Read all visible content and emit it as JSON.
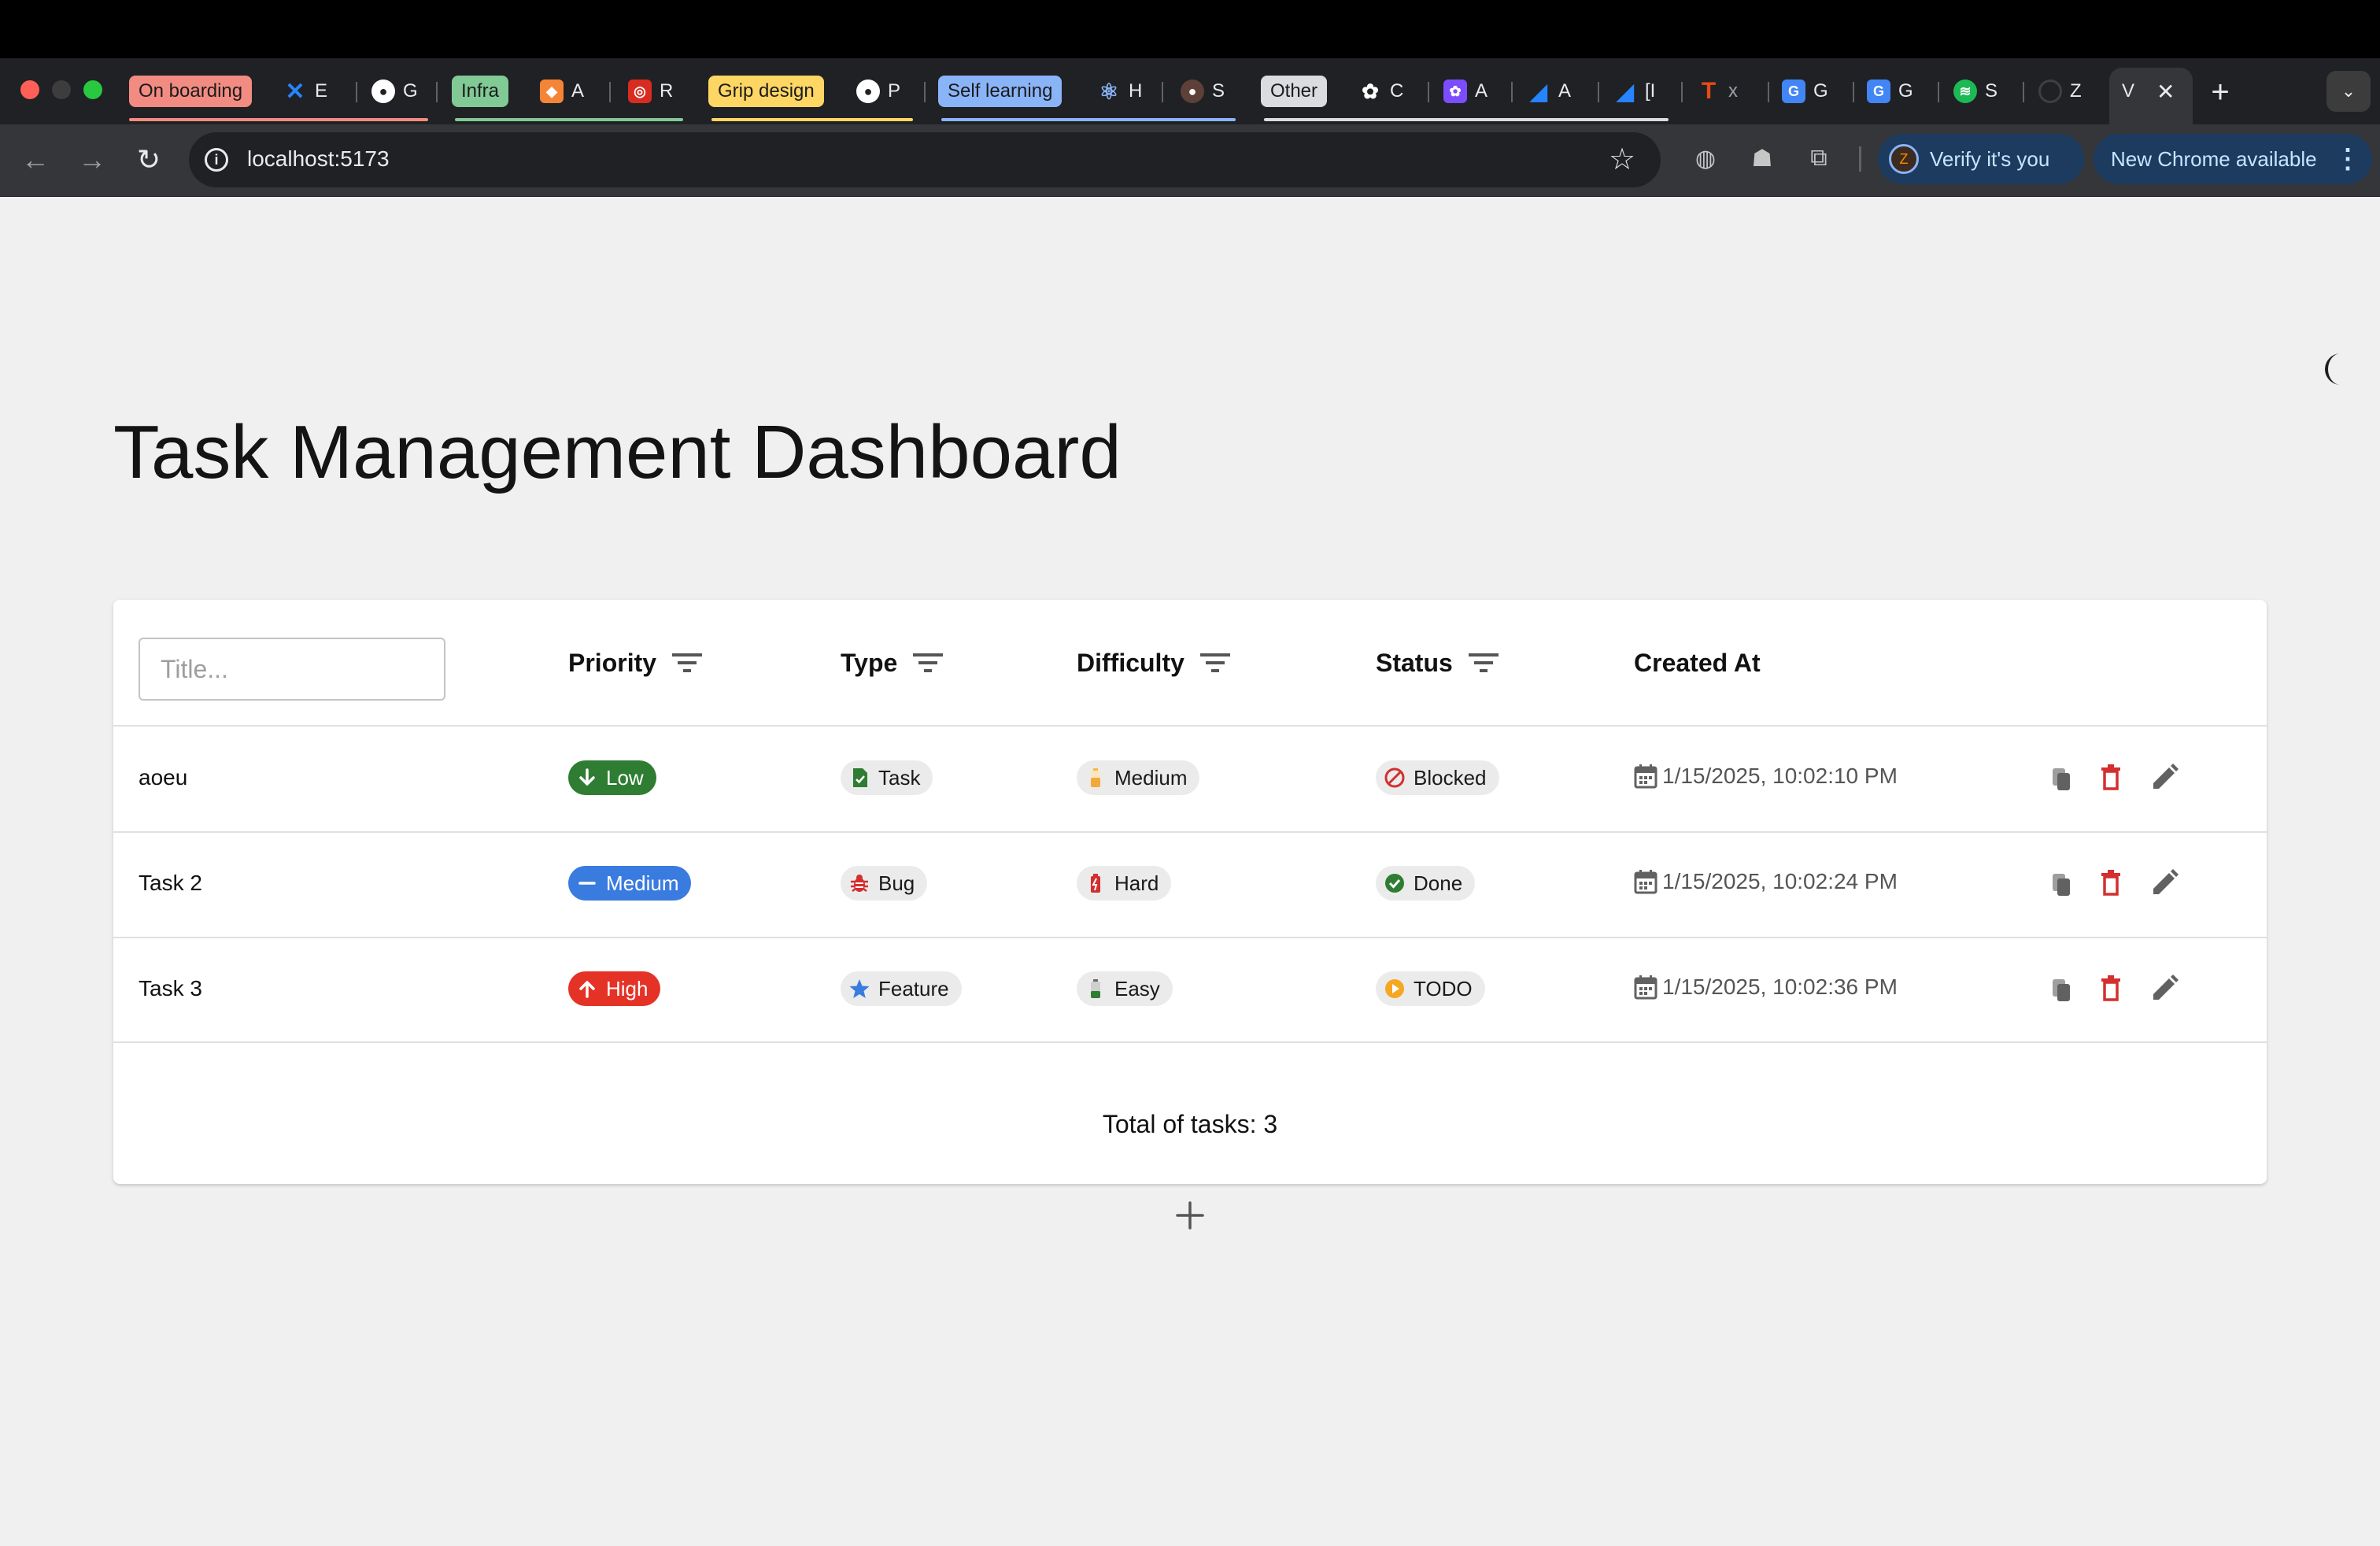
{
  "browser": {
    "tabs": [
      {
        "group": "On boarding",
        "group_color": "#f28b82"
      },
      {
        "label": "E",
        "icon": "confluence-icon"
      },
      {
        "label": "G",
        "icon": "github-icon"
      },
      {
        "group": "Infra",
        "group_color": "#81c995"
      },
      {
        "label": "A",
        "icon": "aws-icon"
      },
      {
        "label": "R",
        "icon": "redis-icon"
      },
      {
        "group": "Grip design",
        "group_color": "#fdd663"
      },
      {
        "label": "P",
        "icon": "github-icon"
      },
      {
        "group": "Self learning",
        "group_color": "#8ab4f8"
      },
      {
        "label": "H",
        "icon": "react-icon"
      },
      {
        "label": "S",
        "icon": "app-icon"
      },
      {
        "group": "Other",
        "group_color": "#dadce0"
      },
      {
        "label": "C",
        "icon": "openai-icon"
      },
      {
        "label": "A",
        "icon": "ai-icon"
      },
      {
        "label": "A",
        "icon": "jira-icon"
      },
      {
        "label": "[I",
        "icon": "jira-icon"
      },
      {
        "label": "x",
        "icon": "t-icon"
      },
      {
        "label": "G",
        "icon": "google-g-icon"
      },
      {
        "label": "G",
        "icon": "google-g-icon"
      },
      {
        "label": "S",
        "icon": "spotify-icon"
      },
      {
        "label": "Z",
        "icon": "loading-icon"
      },
      {
        "label": "V",
        "icon": "vite-icon",
        "active": true
      }
    ],
    "new_tab": "+",
    "url": "localhost:5173",
    "verify_label": "Verify it's you",
    "verify_avatar": "Z",
    "update_label": "New Chrome available"
  },
  "page": {
    "title": "Task Management Dashboard",
    "filter_placeholder": "Title...",
    "columns": [
      "Priority",
      "Type",
      "Difficulty",
      "Status",
      "Created At"
    ],
    "tasks": [
      {
        "title": "aoeu",
        "priority": "Low",
        "priority_icon": "arrow-down-icon",
        "priority_color": "#2e7d32",
        "type": "Task",
        "type_icon": "task-icon",
        "difficulty": "Medium",
        "difficulty_icon": "battery-medium-icon",
        "status": "Blocked",
        "status_icon": "blocked-icon",
        "created_at": "1/15/2025, 10:02:10 PM"
      },
      {
        "title": "Task 2",
        "priority": "Medium",
        "priority_icon": "minus-icon",
        "priority_color": "#3a7be0",
        "type": "Bug",
        "type_icon": "bug-icon",
        "difficulty": "Hard",
        "difficulty_icon": "battery-low-icon",
        "status": "Done",
        "status_icon": "check-circle-icon",
        "created_at": "1/15/2025, 10:02:24 PM"
      },
      {
        "title": "Task 3",
        "priority": "High",
        "priority_icon": "arrow-up-icon",
        "priority_color": "#e53226",
        "type": "Feature",
        "type_icon": "star-icon",
        "difficulty": "Easy",
        "difficulty_icon": "battery-full-icon",
        "status": "TODO",
        "status_icon": "play-circle-icon",
        "created_at": "1/15/2025, 10:02:36 PM"
      }
    ],
    "total_label": "Total of tasks: 3",
    "colors": {
      "delete": "#d32f2f",
      "action_grey": "#616161"
    }
  }
}
